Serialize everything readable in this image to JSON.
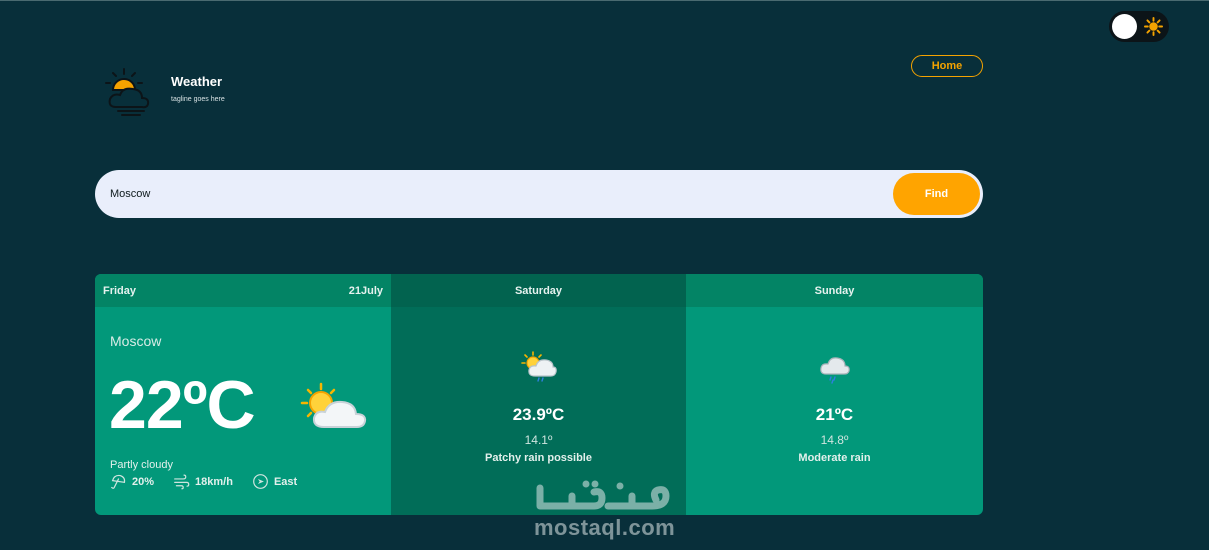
{
  "theme_toggle": {
    "state": "light",
    "icon": "sun-icon"
  },
  "brand": {
    "title": "Weather",
    "tagline": "tagline goes here",
    "logo_icon": "sun-cloud-icon"
  },
  "nav": {
    "home_label": "Home"
  },
  "search": {
    "value": "Moscow",
    "find_label": "Find"
  },
  "today": {
    "day": "Friday",
    "date": "21July",
    "city": "Moscow",
    "temp": "22ºC",
    "icon": "partly-cloudy-icon",
    "condition": "Partly cloudy",
    "rain": "20%",
    "wind": "18km/h",
    "direction": "East"
  },
  "forecast": [
    {
      "day": "Saturday",
      "max": "23.9ºC",
      "min": "14.1º",
      "condition": "Patchy rain possible",
      "icon": "sun-cloud-rain-icon"
    },
    {
      "day": "Sunday",
      "max": "21ºC",
      "min": "14.8º",
      "condition": "Moderate rain",
      "icon": "cloud-rain-icon"
    }
  ],
  "watermark": {
    "text": "mostaql.com",
    "logo": "مستقل"
  },
  "colors": {
    "background": "#082f3a",
    "accent": "#ffa400",
    "card": "#02987a",
    "card_dark": "#016d58"
  }
}
